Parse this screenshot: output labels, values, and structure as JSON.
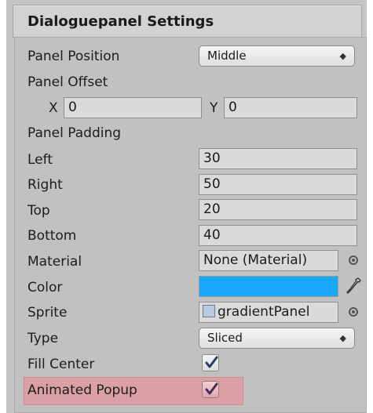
{
  "header": {
    "title": "Dialoguepanel Settings"
  },
  "panel_position": {
    "label": "Panel Position",
    "value": "Middle",
    "arrow": "◆"
  },
  "panel_offset": {
    "label": "Panel Offset",
    "x_label": "X",
    "x_value": "0",
    "y_label": "Y",
    "y_value": "0"
  },
  "panel_padding": {
    "label": "Panel Padding",
    "left_label": "Left",
    "left_value": "30",
    "right_label": "Right",
    "right_value": "50",
    "top_label": "Top",
    "top_value": "20",
    "bottom_label": "Bottom",
    "bottom_value": "40"
  },
  "material": {
    "label": "Material",
    "value": "None (Material)"
  },
  "color": {
    "label": "Color",
    "swatch": "#17a8fb"
  },
  "sprite": {
    "label": "Sprite",
    "value": "gradientPanel",
    "icon": "sprite-icon"
  },
  "type": {
    "label": "Type",
    "value": "Sliced",
    "arrow": "◆"
  },
  "fill_center": {
    "label": "Fill Center",
    "checked": true
  },
  "animated_popup": {
    "label": "Animated Popup",
    "checked": true,
    "highlight_color": "#dba0a4"
  }
}
